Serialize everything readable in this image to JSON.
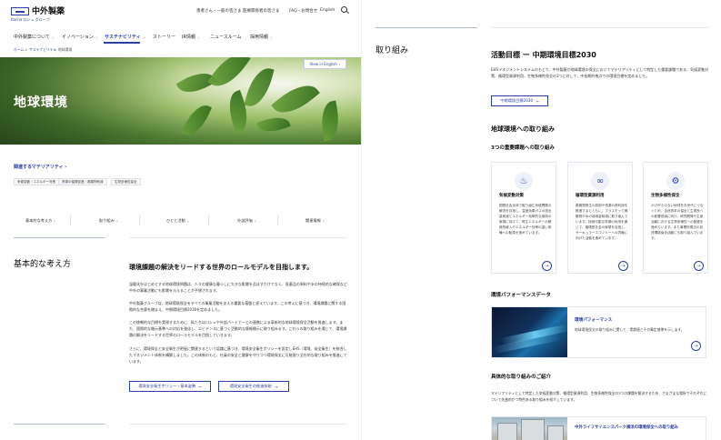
{
  "header": {
    "logo_text": "中外製薬",
    "logo_sub": "Roche  ロシュ グループ",
    "util_links": [
      "患者さん・一般の皆さま",
      "医療関係者の皆さま",
      "FAQ・お問合せ",
      "English"
    ],
    "nav": [
      "中外製薬について",
      "イノベーション",
      "サステナビリティ",
      "ストーリー",
      "IR情報",
      "ニュースルーム",
      "採用情報"
    ],
    "nav_active": "サステナビリティ"
  },
  "breadcrumb": [
    "ホーム",
    "サステナビリティ",
    "地球環境"
  ],
  "hero": {
    "title": "地球環境",
    "view_english": "View in English"
  },
  "materiality": {
    "link": "関連するマテリアリティ",
    "tags": [
      "気候変動・エネルギー対策",
      "資源の循環促進・廃棄物削減",
      "生物多様性保全"
    ]
  },
  "subnav": [
    "基本的な考え方",
    "取り組み",
    "ひとと活動",
    "外部評価",
    "関連情報"
  ],
  "basic": {
    "heading": "基本的な考え方",
    "lead": "環境課題の解決をリードする世界のロールモデルを目指します。",
    "paragraphs": [
      "温暖化をはじめとする地球環境問題は、人々の健康な暮らしに大きな影響を及ぼすだけでなく、医薬品の原料や水の持続的な確保など中外の事業活動にも影響を与えることが予想されます。",
      "中外製薬グループは、地球環境保全をすべての事業活動を支える重要な基盤と捉えています。この考えに基づき、環境課題に関する国際的な合意を踏まえ、中期環境目標2030を定めました。",
      "この挑戦的な目標を実現するために、私たちはロシュや外部パートナーとの連携による革新的な地球環境保全活動を推進します。また、国際的な開示基準への対応を強化し、エビデンスに基づく活動的な情報開示に取り組みます。これらの取り組みを通じて、環境課題の解決をリードする世界のロールモデルを目指していきます。",
      "さらに、環境保全と安全衛生が密接に関連するという認識に基づき、環境安全衛生ポリシーを設定しEHS（環境、安全衛生）を統合したマネジメント体制を構築しました。この体制のもと、社員の安全と健康を守りつつ環境保全に可能限り全社的な取り組みを推進しています。"
    ],
    "buttons": [
      "環境安全衛生ポリシー・基本姿勢",
      "環境安全衛生の推進体制"
    ]
  },
  "right": {
    "section_title": "取り組み",
    "goal_heading": "活動目標 ー 中期環境目標2030",
    "goal_text": "EHSマネジメントシステムのもとで、中外製薬が地球環境の保全においてマテリアリティとして特定した重要課題である、気候変動対策、循環型資源利用、生物多様性保全の3つに対して、中長期的視点での環境目標を定めました。",
    "goal_button": "中期環境目標2030",
    "efforts_heading": "地球環境への取り組み",
    "issues_heading": "3つの重要課題への取り組み",
    "cards": [
      {
        "icon": "thermometer-icon",
        "glyph": "♨",
        "title": "気候変動対策",
        "text": "国際社会全体で取り組む気候問題の解決を目指し、温室効果ガスの排出量削減とエネルギー効率的な使用の実現に向けて、再生エネルギーの積極的導入やエネルギー効率の高い設備への転換を進めています。"
      },
      {
        "icon": "infinity-icon",
        "glyph": "∞",
        "title": "循環型資源利用",
        "text": "廃棄物発生の抑制や資源の再利用を推進するとともに、プラスチック廃棄物や水の使用量削減に取り組んでいます。持続可能な資源の利用を通じて、循環型社会の実現を目指し、サーキュラーエコノミーへの貢献に向けた活動を進めています。"
      },
      {
        "icon": "gears-icon",
        "glyph": "⚙",
        "title": "生物多様性保全",
        "text": "かけがえのない地球を次世代につなぐため、自然資本の保全と生態系への影響低減に向け、研究開発や生産活動における生物多様性への配慮を進めています。また事業所周辺の自然環境保全活動にも取り組んでいます。"
      }
    ],
    "perf_heading": "環境パフォーマンスデータ",
    "perf_title": "環境パフォーマンス",
    "perf_text": "地球環境保全の取り組みに関して、実績値とその算定基準を示します。",
    "examples_heading": "具体的な取り組みのご紹介",
    "examples_text": "マテリアリティとして特定した気候変動対策、循環型資源利用、生物多様性保全の3つの課題を解決するため、さまざまな場所でそれぞれについて先進的かつ特色ある取り組みを紹介しています。",
    "intro_title": "中外ライフサイエンスパーク横浜の環境保全への取り組み"
  },
  "colors": {
    "accent": "#2b3fa0",
    "text": "#222222",
    "border": "#e3e6ec"
  }
}
